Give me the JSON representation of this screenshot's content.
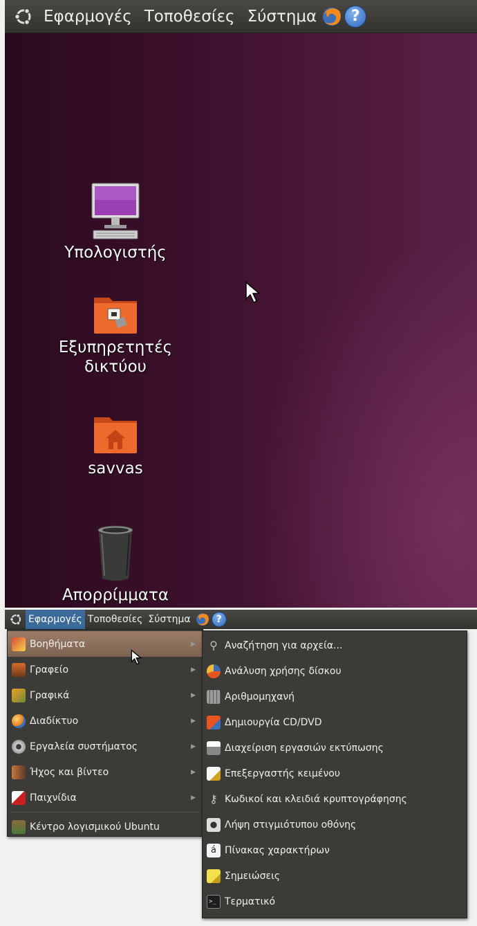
{
  "top_panel": {
    "applications": "Εφαρμογές",
    "places": "Τοποθεσίες",
    "system": "Σύστημα",
    "firefox_icon": "firefox-icon",
    "help_icon": "help-icon",
    "help_glyph": "?"
  },
  "desktop": {
    "icons": [
      {
        "label": "Υπολογιστής",
        "icon": "computer-icon"
      },
      {
        "label_line1": "Εξυπηρετητές",
        "label_line2": "δικτύου",
        "icon": "network-servers-icon"
      },
      {
        "label": "savvas",
        "icon": "home-folder-icon"
      },
      {
        "label": "Απορρίμματα",
        "icon": "trash-icon"
      }
    ]
  },
  "bottom_panel": {
    "applications": "Εφαρμογές",
    "places": "Τοποθεσίες",
    "system": "Σύστημα",
    "help_glyph": "?"
  },
  "applications_menu": {
    "items": [
      {
        "label": "Βοηθήματα",
        "icon": "accessories-icon",
        "submenu": true,
        "hovered": true
      },
      {
        "label": "Γραφείο",
        "icon": "office-icon",
        "submenu": true
      },
      {
        "label": "Γραφικά",
        "icon": "graphics-icon",
        "submenu": true
      },
      {
        "label": "Διαδίκτυο",
        "icon": "internet-icon",
        "submenu": true
      },
      {
        "label": "Εργαλεία συστήματος",
        "icon": "system-tools-icon",
        "submenu": true
      },
      {
        "label": "Ήχος και βίντεο",
        "icon": "sound-video-icon",
        "submenu": true
      },
      {
        "label": "Παιχνίδια",
        "icon": "games-icon",
        "submenu": true
      },
      {
        "label": "Κέντρο λογισμικού Ubuntu",
        "icon": "software-center-icon",
        "submenu": false
      }
    ]
  },
  "accessories_submenu": {
    "items": [
      {
        "label": "Αναζήτηση για αρχεία...",
        "icon": "search-icon"
      },
      {
        "label": "Ανάλυση χρήσης δίσκου",
        "icon": "disk-usage-icon"
      },
      {
        "label": "Αριθμομηχανή",
        "icon": "calculator-icon"
      },
      {
        "label": "Δημιουργία CD/DVD",
        "icon": "cd-dvd-creator-icon"
      },
      {
        "label": "Διαχείριση εργασιών εκτύπωσης",
        "icon": "printer-icon"
      },
      {
        "label": "Επεξεργαστής κειμένου",
        "icon": "text-editor-icon"
      },
      {
        "label": "Κωδικοί και κλειδιά κρυπτογράφησης",
        "icon": "keys-icon"
      },
      {
        "label": "Λήψη στιγμιότυπου οθόνης",
        "icon": "screenshot-icon"
      },
      {
        "label": "Πίνακας χαρακτήρων",
        "icon": "character-map-icon",
        "glyph": "á"
      },
      {
        "label": "Σημειώσεις",
        "icon": "notes-icon"
      },
      {
        "label": "Τερματικό",
        "icon": "terminal-icon"
      }
    ]
  },
  "colors": {
    "panel": "#3c3b37",
    "desktop_aubergine": "#3a0f2a",
    "menu_hover": "#8a6f5c",
    "ubuntu_orange": "#e95420"
  }
}
